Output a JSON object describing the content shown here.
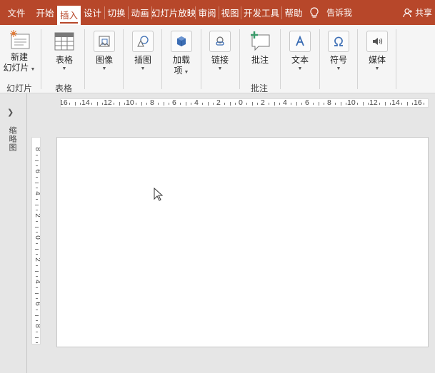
{
  "tabs": [
    "文件",
    "开始",
    "插入",
    "设计",
    "切换",
    "动画",
    "幻灯片放映",
    "审阅",
    "视图",
    "开发工具",
    "帮助"
  ],
  "active_tab_index": 2,
  "tell_me": "告诉我",
  "share": "共享",
  "ribbon": {
    "new_slide": {
      "line1": "新建",
      "line2": "幻灯片"
    },
    "table": "表格",
    "image": "图像",
    "illustration": "插图",
    "addins": {
      "line1": "加载",
      "line2": "项"
    },
    "link": "链接",
    "comment": "批注",
    "text": "文本",
    "symbol": "符号",
    "media": "媒体",
    "groups": {
      "slides": "幻灯片",
      "tables": "表格",
      "comments": "批注"
    }
  },
  "thumbnail_pane": {
    "label": "缩略图"
  },
  "hruler_labels": [
    "16",
    "14",
    "12",
    "10",
    "8",
    "6",
    "4",
    "2",
    "0",
    "2",
    "4",
    "6",
    "8",
    "10",
    "12",
    "14",
    "16"
  ],
  "vruler_labels": [
    "8",
    "6",
    "4",
    "2",
    "0",
    "2",
    "4",
    "6",
    "8"
  ],
  "colors": {
    "accent": "#b7472a",
    "icon_blue": "#3b6db4",
    "ribbon_bg": "#f5f5f5"
  }
}
